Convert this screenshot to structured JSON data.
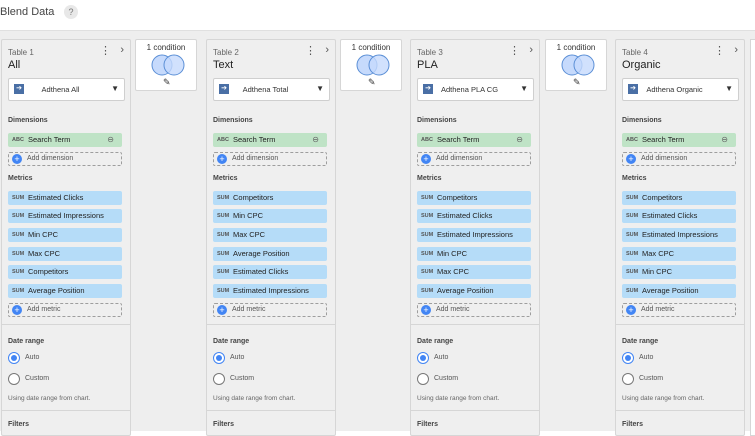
{
  "header": {
    "title": "Blend Data",
    "help_icon": "?"
  },
  "glyphs": {
    "more": "⋮",
    "chevron": "›",
    "dropdown": "▼",
    "link": "⊖",
    "pencil": "✎",
    "plus": "+",
    "ds_icon": "➔"
  },
  "labels": {
    "dimensions": "Dimensions",
    "metrics": "Metrics",
    "date_range": "Date range",
    "filters": "Filters",
    "dim_type": "ABC",
    "met_type": "SUM"
  },
  "tables": [
    {
      "label": "Table 1",
      "name": "All",
      "data_source": "Adthena All",
      "dimensions": [
        "Search Term"
      ],
      "add_dimension": "Add dimension",
      "metrics": [
        "Estimated Clicks",
        "Estimated Impressions",
        "Min CPC",
        "Max CPC",
        "Competitors",
        "Average Position"
      ],
      "add_metric": "Add metric",
      "date_auto": "Auto",
      "date_custom": "Custom",
      "date_note": "Using date range from chart."
    },
    {
      "label": "Table 2",
      "name": "Text",
      "data_source": "Adthena Total",
      "dimensions": [
        "Search Term"
      ],
      "add_dimension": "Add dimension",
      "metrics": [
        "Competitors",
        "Min CPC",
        "Max CPC",
        "Average Position",
        "Estimated Clicks",
        "Estimated Impressions"
      ],
      "add_metric": "Add metric",
      "date_auto": "Auto",
      "date_custom": "Custom",
      "date_note": "Using date range from chart."
    },
    {
      "label": "Table 3",
      "name": "PLA",
      "data_source": "Adthena PLA CG",
      "dimensions": [
        "Search Term"
      ],
      "add_dimension": "Add dimension",
      "metrics": [
        "Competitors",
        "Estimated Clicks",
        "Estimated Impressions",
        "Min CPC",
        "Max CPC",
        "Average Position"
      ],
      "add_metric": "Add metric",
      "date_auto": "Auto",
      "date_custom": "Custom",
      "date_note": "Using date range from chart."
    },
    {
      "label": "Table 4",
      "name": "Organic",
      "data_source": "Adthena Organic",
      "dimensions": [
        "Search Term"
      ],
      "add_dimension": "Add dimension",
      "metrics": [
        "Competitors",
        "Estimated Clicks",
        "Estimated Impressions",
        "Max CPC",
        "Min CPC",
        "Average Position"
      ],
      "add_metric": "Add metric",
      "date_auto": "Auto",
      "date_custom": "Custom",
      "date_note": "Using date range from chart."
    }
  ],
  "join_conditions": [
    "1 condition",
    "1 condition",
    "1 condition"
  ],
  "colors": {
    "dimension_chip": "#bfe3c6",
    "metric_chip": "#b5dcf8",
    "accent": "#4285f4",
    "venn": "#c6dafc"
  }
}
